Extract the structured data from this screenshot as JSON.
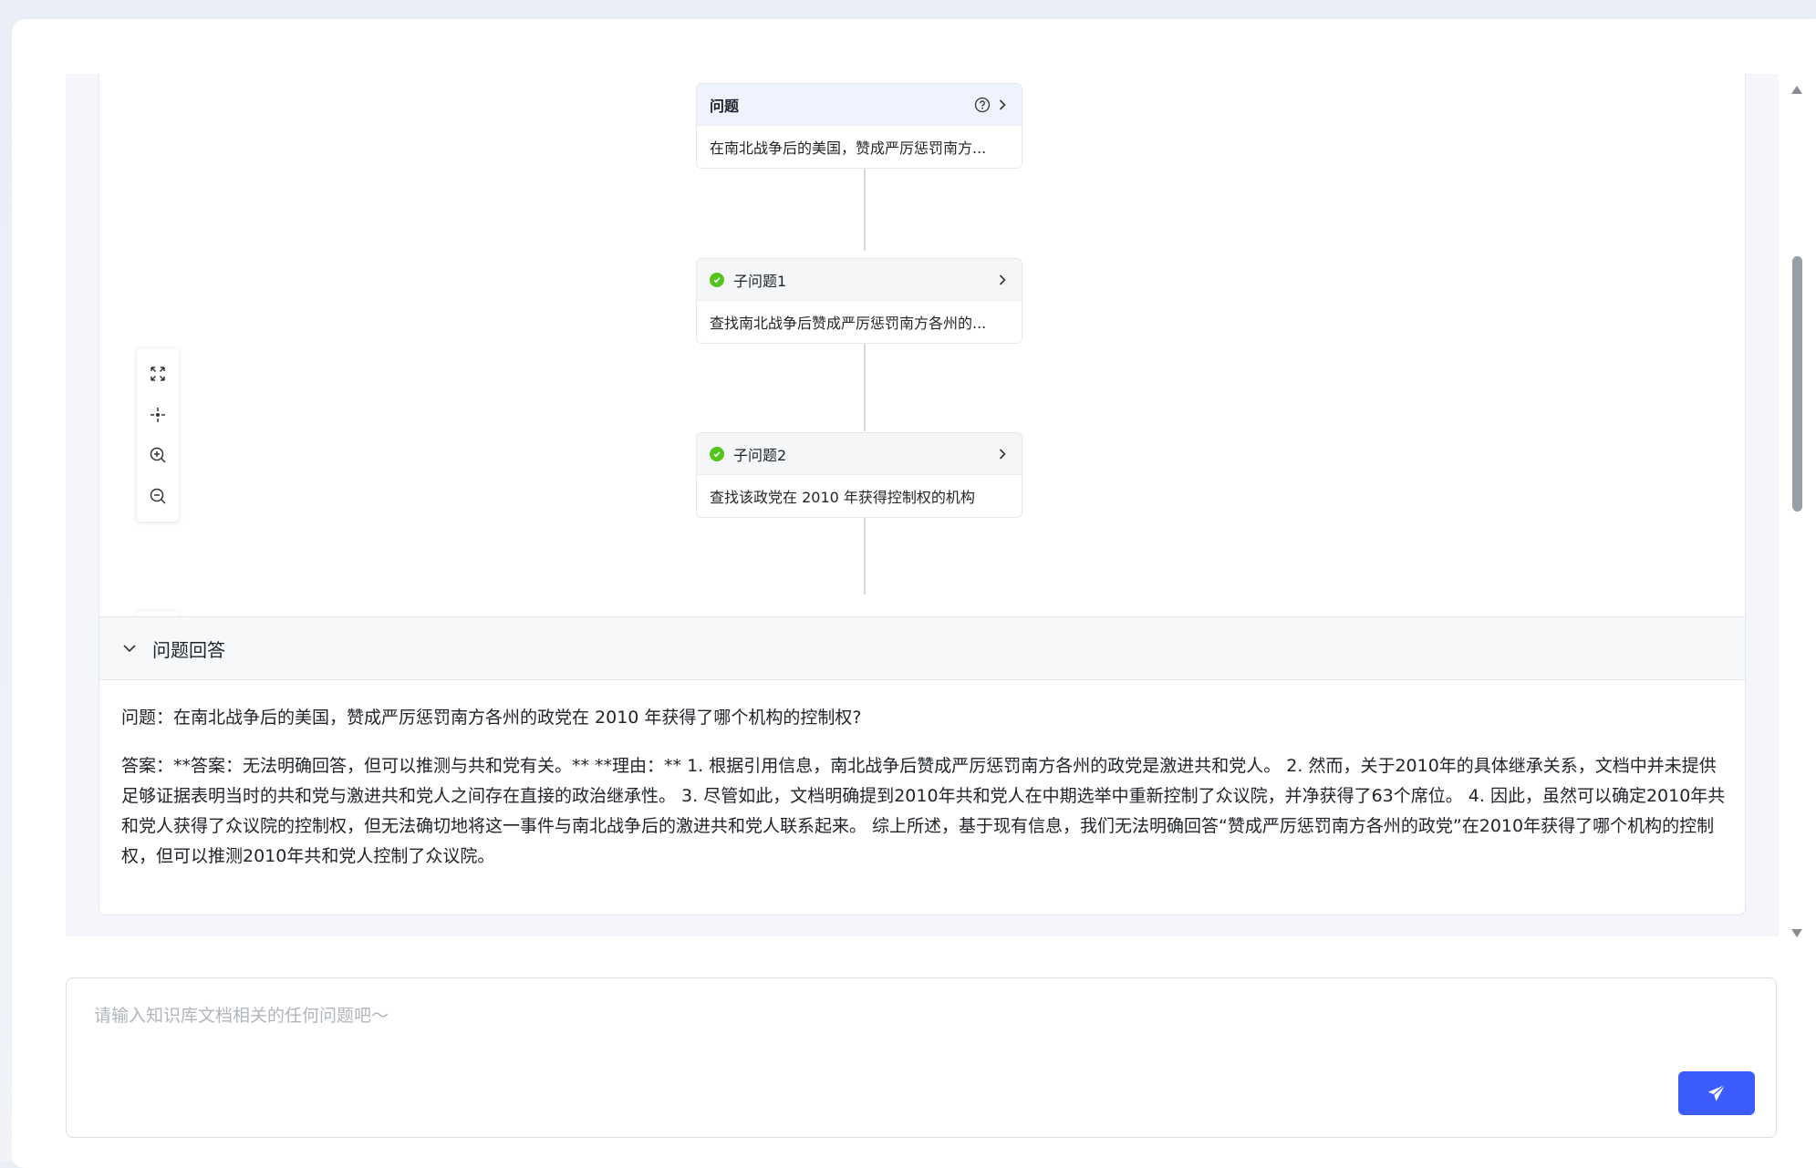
{
  "flow": {
    "nodes": [
      {
        "title": "问题",
        "text": "在南北战争后的美国，赞成严厉惩罚南方..."
      },
      {
        "title": "子问题1",
        "text": "查找南北战争后赞成严厉惩罚南方各州的..."
      },
      {
        "title": "子问题2",
        "text": "查找该政党在 2010 年获得控制权的机构"
      }
    ],
    "status_color": "#52c41a"
  },
  "toolbar": {
    "icons": [
      "fit-view-icon",
      "center-icon",
      "zoom-in-icon",
      "zoom-out-icon",
      "collapse-down-icon"
    ]
  },
  "answer": {
    "section_title": "问题回答",
    "question": "问题：在南北战争后的美国，赞成严厉惩罚南方各州的政党在 2010 年获得了哪个机构的控制权?",
    "answer": "答案：**答案：无法明确回答，但可以推测与共和党有关。** **理由：** 1. 根据引用信息，南北战争后赞成严厉惩罚南方各州的政党是激进共和党人。 2. 然而，关于2010年的具体继承关系，文档中并未提供足够证据表明当时的共和党与激进共和党人之间存在直接的政治继承性。 3. 尽管如此，文档明确提到2010年共和党人在中期选举中重新控制了众议院，并净获得了63个席位。 4. 因此，虽然可以确定2010年共和党人获得了众议院的控制权，但无法确切地将这一事件与南北战争后的激进共和党人联系起来。 综上所述，基于现有信息，我们无法明确回答“赞成严厉惩罚南方各州的政党”在2010年获得了哪个机构的控制权，但可以推测2010年共和党人控制了众议院。"
  },
  "input": {
    "placeholder": "请输入知识库文档相关的任何问题吧～",
    "value": ""
  },
  "colors": {
    "accent": "#3b5bfd",
    "success": "#52c41a",
    "page_bg": "#f4f6fb"
  }
}
